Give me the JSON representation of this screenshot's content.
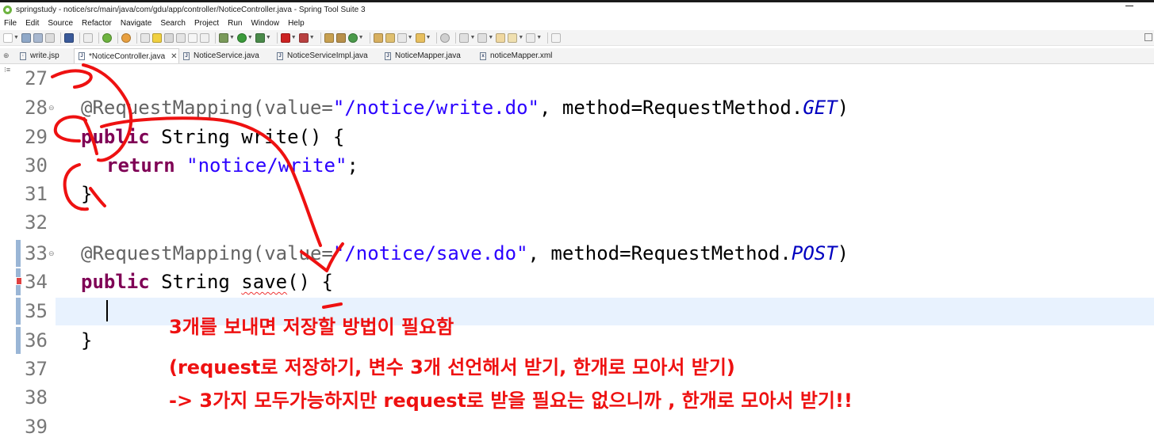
{
  "window": {
    "title": "springstudy - notice/src/main/java/com/gdu/app/controller/NoticeController.java - Spring Tool Suite 3"
  },
  "menu": [
    "File",
    "Edit",
    "Source",
    "Refactor",
    "Navigate",
    "Search",
    "Project",
    "Run",
    "Window",
    "Help"
  ],
  "tabs": [
    {
      "label": "write.jsp",
      "icon": "J"
    },
    {
      "label": "*NoticeController.java",
      "icon": "J",
      "active": true
    },
    {
      "label": "NoticeService.java",
      "icon": "J"
    },
    {
      "label": "NoticeServiceImpl.java",
      "icon": "J"
    },
    {
      "label": "NoticeMapper.java",
      "icon": "J"
    },
    {
      "label": "noticeMapper.xml",
      "icon": "x"
    }
  ],
  "editor": {
    "line_numbers": [
      "27",
      "28",
      "29",
      "30",
      "31",
      "32",
      "33",
      "34",
      "35",
      "36",
      "37",
      "38",
      "39"
    ],
    "lines": {
      "l28": {
        "a1": "@RequestMapping(value=",
        "s1": "\"/notice/write.do\"",
        "p1": ", method=RequestMethod.",
        "e1": "GET",
        "p2": ")"
      },
      "l29": {
        "k1": "public",
        "p1": " String write() {"
      },
      "l30": {
        "k1": "return",
        "s1": "\"notice/write\"",
        "p1": ";"
      },
      "l31": {
        "p1": "}"
      },
      "l33": {
        "a1": "@RequestMapping(value=",
        "s1": "\"/notice/save.do\"",
        "p1": ", method=RequestMethod.",
        "e1": "POST",
        "p2": ")"
      },
      "l34": {
        "k1": "public",
        "p1": " String ",
        "m1": "save",
        "p2": "() {"
      },
      "l36": {
        "p1": "}"
      }
    }
  },
  "annotation_notes": [
    "3개를 보내면 저장할 방법이 필요함",
    "(request로 저장하기, 변수 3개 선언해서 받기, 한개로 모아서 받기)",
    "-> 3가지 모두가능하지만 request로 받을 필요는 없으니까 , 한개로 모아서 받기!!"
  ],
  "colors": {
    "keyword": "#7f0055",
    "string": "#2a00ff",
    "annotation": "#646464",
    "enum_constant": "#0000c0",
    "note": "#ee1111",
    "current_line": "#e8f2fe"
  }
}
